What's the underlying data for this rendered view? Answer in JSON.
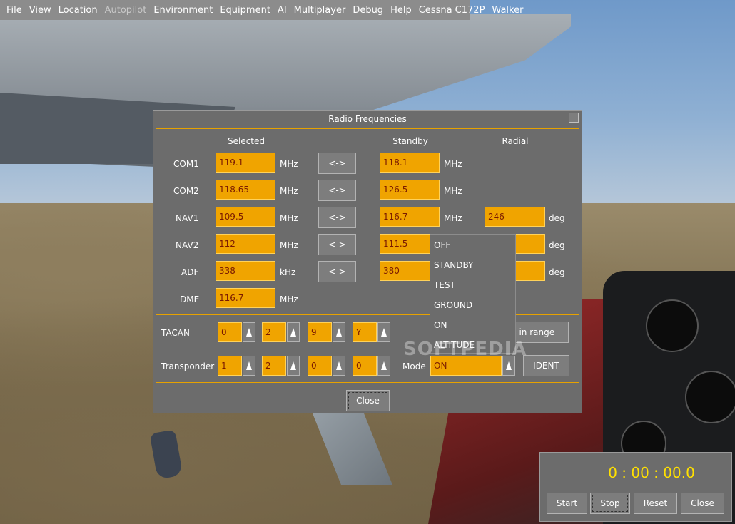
{
  "menu": [
    "File",
    "View",
    "Location",
    "Autopilot",
    "Environment",
    "Equipment",
    "AI",
    "Multiplayer",
    "Debug",
    "Help",
    "Cessna C172P",
    "Walker"
  ],
  "menu_disabled_index": 3,
  "dialog": {
    "title": "Radio Frequencies",
    "headers": {
      "selected": "Selected",
      "standby": "Standby",
      "radial": "Radial"
    },
    "swap_label": "<->",
    "rows": [
      {
        "label": "COM1",
        "selected": "119.1",
        "unit": "MHz",
        "standby": "118.1",
        "standby_unit": "MHz"
      },
      {
        "label": "COM2",
        "selected": "118.65",
        "unit": "MHz",
        "standby": "126.5",
        "standby_unit": "MHz"
      },
      {
        "label": "NAV1",
        "selected": "109.5",
        "unit": "MHz",
        "standby": "116.7",
        "standby_unit": "MHz",
        "radial": "246",
        "radial_unit": "deg"
      },
      {
        "label": "NAV2",
        "selected": "112",
        "unit": "MHz",
        "standby": "111.5",
        "radial_unit": "deg"
      },
      {
        "label": "ADF",
        "selected": "338",
        "unit": "kHz",
        "standby": "380",
        "radial_unit": "deg"
      },
      {
        "label": "DME",
        "selected": "116.7",
        "unit": "MHz"
      }
    ],
    "tacan": {
      "label": "TACAN",
      "values": [
        "0",
        "2",
        "9",
        "Y"
      ],
      "button_partial": "es in range"
    },
    "transponder": {
      "label": "Transponder",
      "values": [
        "1",
        "2",
        "0",
        "0"
      ],
      "mode_label": "Mode",
      "mode_value": "ON",
      "ident": "IDENT"
    },
    "close": "Close"
  },
  "mode_options": [
    "OFF",
    "STANDBY",
    "TEST",
    "GROUND",
    "ON",
    "ALTITUDE"
  ],
  "watermark": "SOFTPEDIA",
  "stopwatch": {
    "time": "0 : 00 : 00.0",
    "buttons": [
      "Start",
      "Stop",
      "Reset",
      "Close"
    ]
  },
  "colors": {
    "field": "#f0a400",
    "field_text": "#7a1a00",
    "separator": "#e7a200",
    "timer": "#ffe000"
  }
}
